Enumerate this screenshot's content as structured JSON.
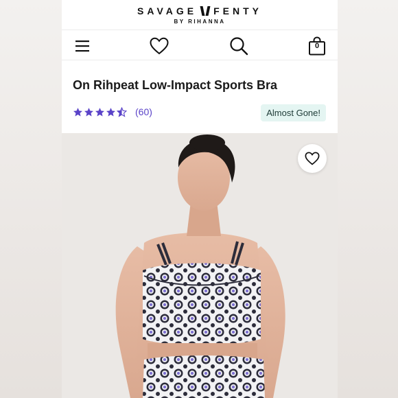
{
  "brand": {
    "name_left": "SAVAGE",
    "name_right": "FENTY",
    "sub": "BY RIHANNA"
  },
  "nav": {
    "menu_icon": "hamburger-menu-icon",
    "wishlist_icon": "heart-outline-icon",
    "search_icon": "search-icon",
    "bag_icon": "shopping-bag-icon",
    "bag_count": "0"
  },
  "product": {
    "title": "On Rihpeat Low-Impact Sports Bra",
    "rating": 4.5,
    "review_count": "(60)",
    "badge": "Almost Gone!"
  },
  "image": {
    "wishlist_icon": "heart-outline-icon"
  },
  "colors": {
    "accent": "#5a43c8",
    "badge_bg": "#e4f5f2",
    "text": "#1a1a1a"
  }
}
